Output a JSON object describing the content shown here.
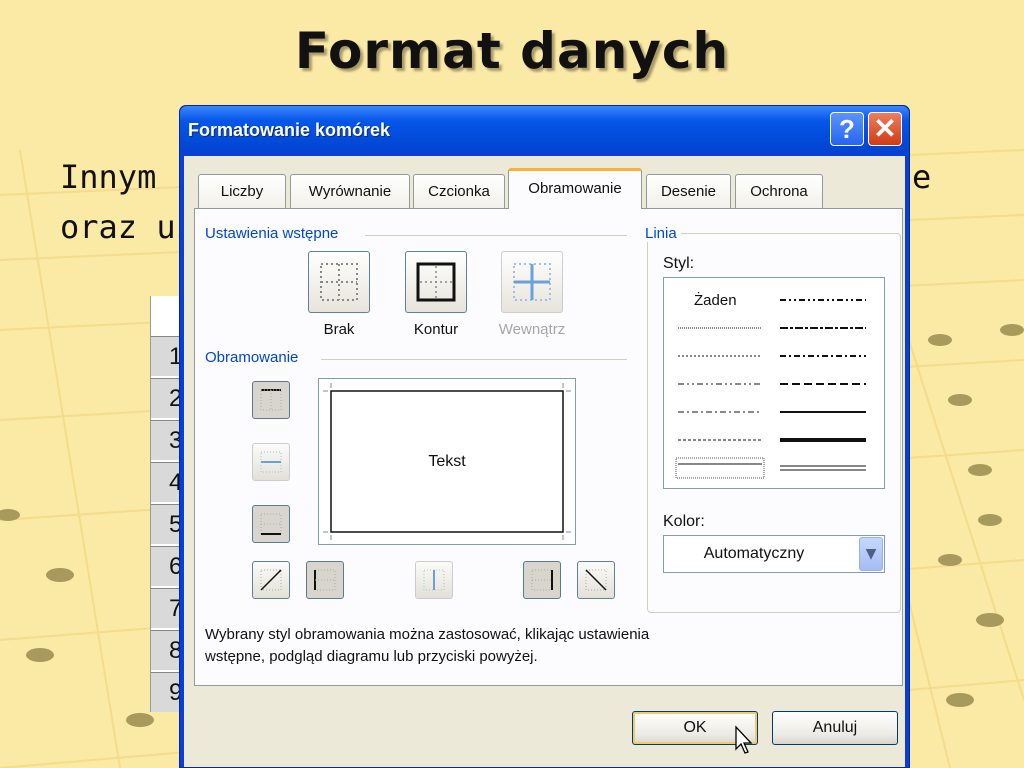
{
  "slide": {
    "title": "Format danych",
    "text_line1_visible": "Innym",
    "text_line1_right": "e",
    "text_line2_visible": "oraz us"
  },
  "sheet": {
    "row_numbers": [
      "1",
      "2",
      "3",
      "4",
      "5",
      "6",
      "7",
      "8",
      "9"
    ]
  },
  "dialog": {
    "title": "Formatowanie komórek",
    "help_label": "?",
    "close_label": "✕",
    "tabs": [
      {
        "label": "Liczby",
        "active": false
      },
      {
        "label": "Wyrównanie",
        "active": false
      },
      {
        "label": "Czcionka",
        "active": false
      },
      {
        "label": "Obramowanie",
        "active": true
      },
      {
        "label": "Desenie",
        "active": false
      },
      {
        "label": "Ochrona",
        "active": false
      }
    ],
    "presets": {
      "group_label": "Ustawienia wstępne",
      "items": [
        {
          "label": "Brak",
          "enabled": true,
          "icon": "border-none-icon"
        },
        {
          "label": "Kontur",
          "enabled": true,
          "icon": "border-outline-icon"
        },
        {
          "label": "Wewnątrz",
          "enabled": false,
          "icon": "border-inside-icon"
        }
      ]
    },
    "border": {
      "group_label": "Obramowanie",
      "preview_text": "Tekst"
    },
    "line": {
      "group_label": "Linia",
      "style_label": "Styl:",
      "none_label": "Żaden",
      "color_label": "Kolor:",
      "color_value": "Automatyczny"
    },
    "hint_line1": "Wybrany styl obramowania można zastosować, klikając ustawienia",
    "hint_line2": "wstępne, podgląd diagramu lub przyciski powyżej.",
    "ok_label": "OK",
    "cancel_label": "Anuluj"
  },
  "colors": {
    "slide_bg": "#fbe9a6",
    "xp_title_blue": "#0147d4",
    "group_label_blue": "#0046d5",
    "active_tab_accent": "#f7b23a"
  }
}
